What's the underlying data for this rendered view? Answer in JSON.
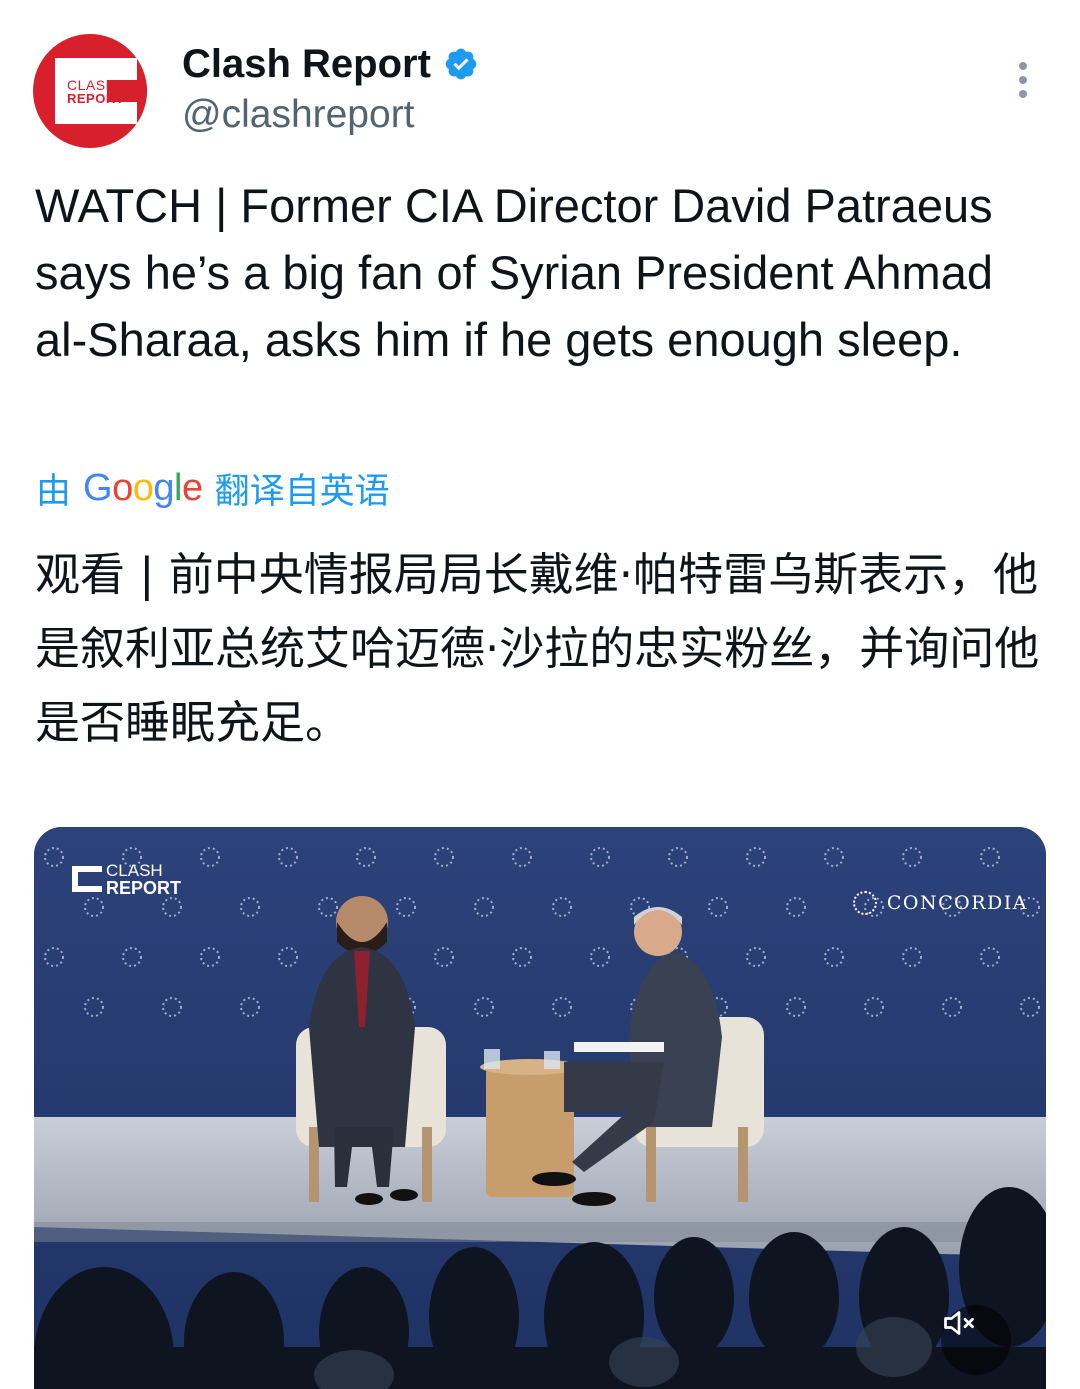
{
  "account": {
    "display_name": "Clash Report",
    "handle": "@clashreport",
    "avatar_line1": "CLASH",
    "avatar_line2": "REPORT",
    "verified": true
  },
  "tweet": {
    "text": "WATCH | Former CIA Director David Patraeus says he’s a big fan of Syrian President Ahmad al-Sharaa, asks him if he gets enough sleep.",
    "translation_prefix": "由",
    "translation_brand": "Google",
    "translation_suffix": "翻译自英语",
    "translated_text": "观看 | 前中央情报局局长戴维·帕特雷乌斯表示，他是叙利亚总统艾哈迈德·沙拉的忠实粉丝，并询问他是否睡眠充足。"
  },
  "media": {
    "watermark_line1": "CLASH",
    "watermark_line2": "REPORT",
    "backdrop_brand": "CONCORDIA",
    "mute_icon": "speaker-muted-icon"
  },
  "colors": {
    "accent": "#1d9bf0",
    "brand_red": "#d8202c",
    "text_primary": "#0f1419",
    "text_secondary": "#536471",
    "stage_blue": "#263b6e"
  }
}
